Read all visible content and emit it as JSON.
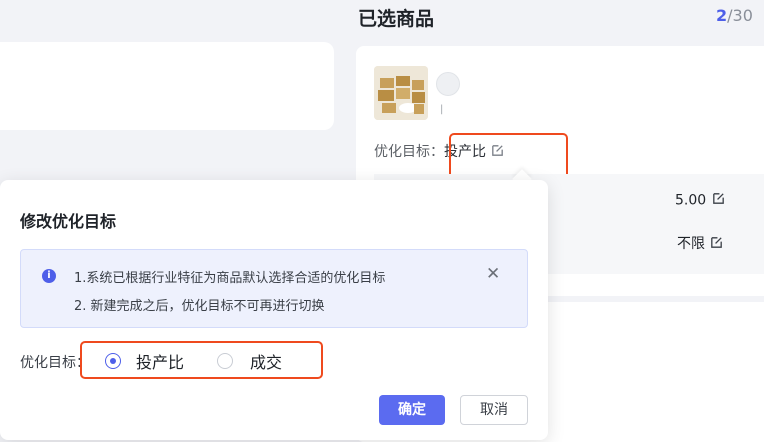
{
  "header": {
    "title": "已选商品",
    "count_selected": "2",
    "count_total": "/30"
  },
  "product_card": {
    "goal_label": "优化目标：",
    "goal_value": "投产比",
    "value_1": "5.00",
    "value_2": "不限"
  },
  "popover": {
    "title": "修改优化目标",
    "info_line_1": "1.系统已根据行业特征为商品默认选择合适的优化目标",
    "info_line_2": "2. 新建完成之后，优化目标不可再进行切换",
    "close_glyph": "✕",
    "field_label": "优化目标：",
    "options": [
      {
        "label": "投产比",
        "selected": true
      },
      {
        "label": "成交",
        "selected": false
      }
    ],
    "confirm_label": "确定",
    "cancel_label": "取消"
  },
  "colors": {
    "accent": "#4e5fe9",
    "highlight": "#ef4a1e"
  }
}
